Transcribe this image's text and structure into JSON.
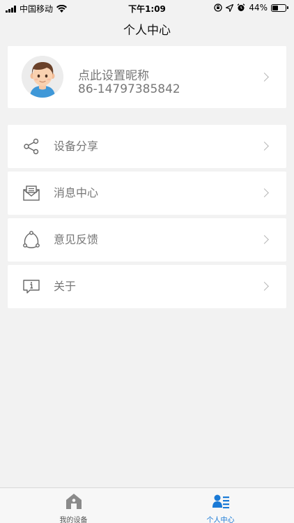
{
  "status_bar": {
    "carrier": "中国移动",
    "time": "下午1:09",
    "battery_percent": "44%",
    "battery_level": 0.44
  },
  "header": {
    "title": "个人中心"
  },
  "profile": {
    "nickname": "点此设置昵称",
    "phone": "86-14797385842"
  },
  "menu": {
    "items": [
      {
        "label": "设备分享",
        "icon": "share-icon"
      },
      {
        "label": "消息中心",
        "icon": "message-icon"
      },
      {
        "label": "意见反馈",
        "icon": "feedback-icon"
      },
      {
        "label": "关于",
        "icon": "info-icon"
      }
    ]
  },
  "tab_bar": {
    "tabs": [
      {
        "label": "我的设备",
        "icon": "home-icon",
        "active": false
      },
      {
        "label": "个人中心",
        "icon": "user-list-icon",
        "active": true
      }
    ],
    "active_color": "#1a7ad6",
    "inactive_color": "#555555"
  }
}
